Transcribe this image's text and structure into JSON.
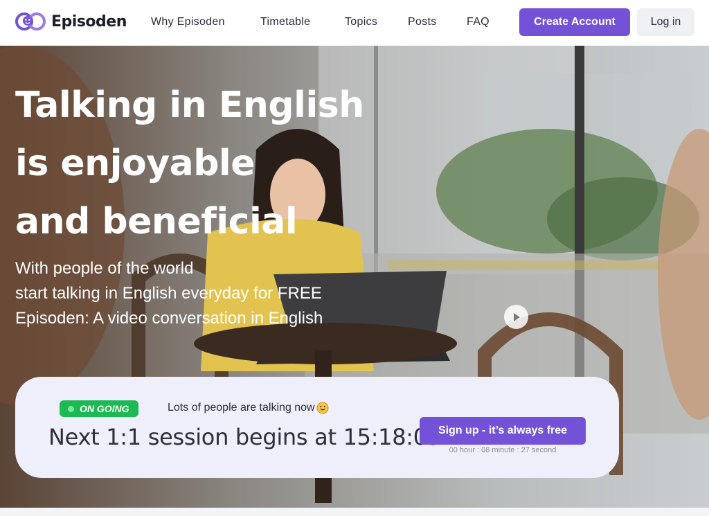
{
  "brand": {
    "name": "Episoden",
    "logo_icon": "episoden-logo-icon",
    "accent": "#7352d8"
  },
  "nav": {
    "items": [
      {
        "label": "Why Episoden"
      },
      {
        "label": "Timetable"
      },
      {
        "label": "Topics"
      },
      {
        "label": "Posts"
      },
      {
        "label": "FAQ"
      }
    ],
    "create_account": "Create Account",
    "login": "Log in"
  },
  "hero": {
    "title_lines": [
      "Talking in English",
      "is enjoyable",
      "and beneficial"
    ],
    "subtitle_lines": [
      "With people of the world",
      "start talking in English everyday for FREE",
      "Episoden: A video conversation in English"
    ],
    "play_icon": "play-icon"
  },
  "session": {
    "badge": "ON GOING",
    "badge_color": "#1db954",
    "talking_text": "Lots of people are talking now",
    "talking_emoji": "smiling-face-icon",
    "next_session_text": "Next 1:1 session begins at 15:18:05",
    "signup_label": "Sign up - it’s always free",
    "countdown": "00 hour : 08 minute : 27 second"
  }
}
